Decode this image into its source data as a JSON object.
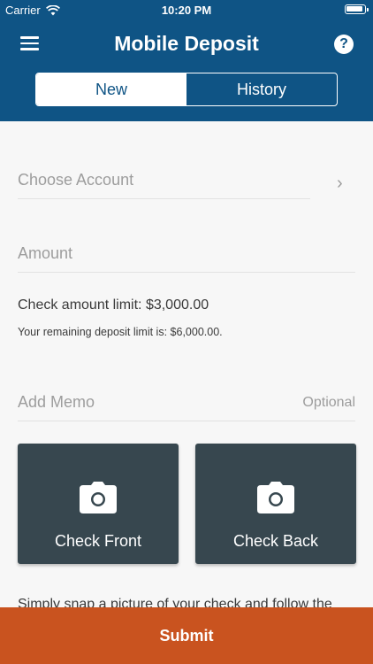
{
  "status_bar": {
    "carrier": "Carrier",
    "time": "10:20 PM"
  },
  "header": {
    "title": "Mobile Deposit",
    "menu_icon": "hamburger-menu-icon",
    "help_icon": "question-circle-icon",
    "help_glyph": "?",
    "tabs": [
      {
        "label": "New",
        "active": true
      },
      {
        "label": "History",
        "active": false
      }
    ]
  },
  "form": {
    "account_label": "Choose Account",
    "chevron_glyph": "›",
    "amount_label": "Amount",
    "check_amount_limit": "Check amount limit: $3,000.00",
    "remaining_limit": "Your remaining deposit limit is: $6,000.00.",
    "memo_label": "Add Memo",
    "memo_hint": "Optional"
  },
  "capture": {
    "front_label": "Check Front",
    "back_label": "Check Back",
    "icon": "camera-icon"
  },
  "instructions": "Simply snap a picture of your check and follow the",
  "submit_label": "Submit",
  "colors": {
    "header": "#0f5485",
    "tile": "#37474f",
    "submit": "#c9531f"
  }
}
